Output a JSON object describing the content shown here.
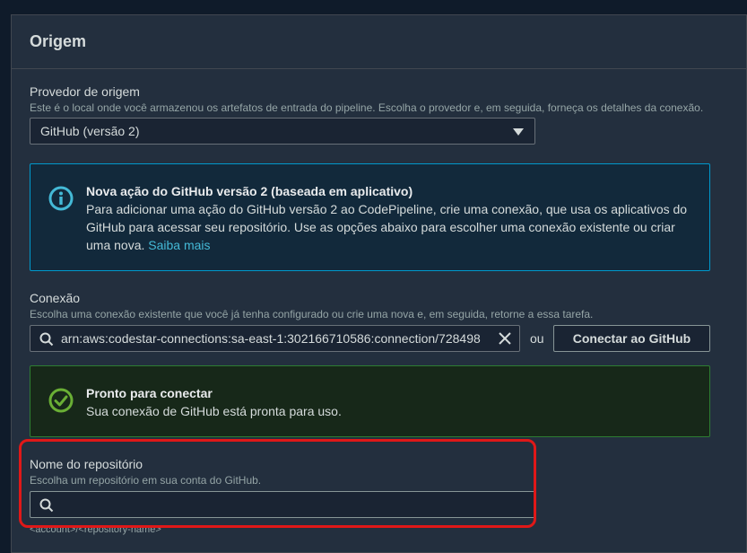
{
  "section": {
    "title": "Origem"
  },
  "provider": {
    "label": "Provedor de origem",
    "description": "Este é o local onde você armazenou os artefatos de entrada do pipeline. Escolha o provedor e, em seguida, forneça os detalhes da conexão.",
    "selected": "GitHub (versão 2)"
  },
  "info_alert": {
    "title": "Nova ação do GitHub versão 2 (baseada em aplicativo)",
    "line1": "Para adicionar uma ação do GitHub versão 2 ao CodePipeline, crie uma conexão, que usa os aplicativos do",
    "line2": "GitHub para acessar seu repositório. Use as opções abaixo para escolher uma conexão existente ou criar",
    "line3_text": "uma nova.",
    "link": "Saiba mais"
  },
  "connection": {
    "label": "Conexão",
    "description": "Escolha uma conexão existente que você já tenha configurado ou crie uma nova e, em seguida, retorne a essa tarefa.",
    "value": "arn:aws:codestar-connections:sa-east-1:302166710586:connection/728498",
    "or_text": "ou",
    "button_label": "Conectar ao GitHub"
  },
  "success_alert": {
    "title": "Pronto para conectar",
    "text": "Sua conexão de GitHub está pronta para uso."
  },
  "repository": {
    "label": "Nome do repositório",
    "description": "Escolha um repositório em sua conta do GitHub.",
    "value": "",
    "hint": "<account>/<repository-name>"
  },
  "colors": {
    "background": "#232f3e",
    "info_border": "#0099cc",
    "success_border": "#2e7d32",
    "link": "#44b9d6",
    "highlight": "#e01818"
  },
  "icons": {
    "provider_dropdown": "caret-down-icon",
    "info": "info-icon",
    "success": "check-circle-icon",
    "search": "search-icon",
    "clear": "close-icon"
  }
}
